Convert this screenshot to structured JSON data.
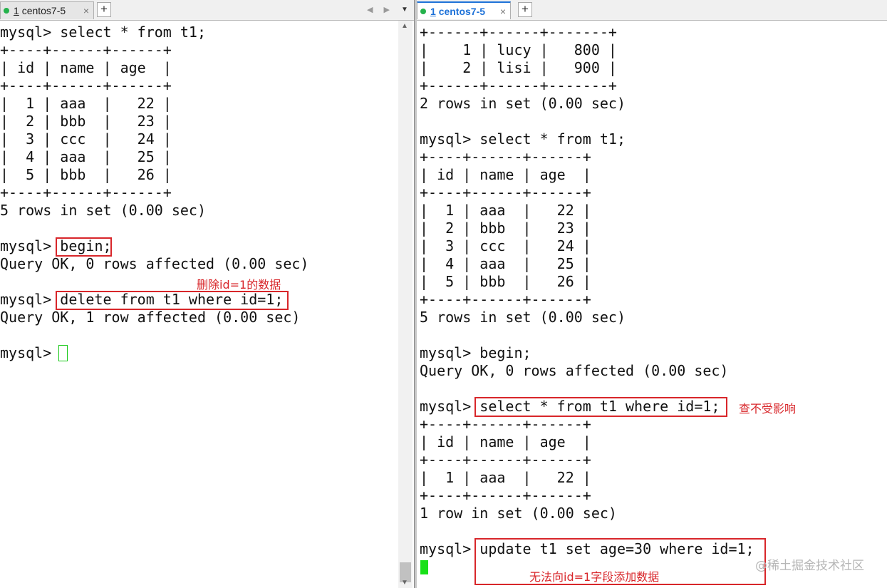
{
  "left": {
    "tab": {
      "num": "1",
      "title": "centos7-5",
      "close": "×"
    },
    "add_tab": "+",
    "nav_arrows": "◀ ▶",
    "menu_arrow": "▼",
    "scroll": {
      "up": "▲",
      "down": "▼"
    },
    "lines": [
      "mysql> select * from t1;",
      "+----+------+------+",
      "| id | name | age  |",
      "+----+------+------+",
      "|  1 | aaa  |   22 |",
      "|  2 | bbb  |   23 |",
      "|  3 | ccc  |   24 |",
      "|  4 | aaa  |   25 |",
      "|  5 | bbb  |   26 |",
      "+----+------+------+",
      "5 rows in set (0.00 sec)",
      "",
      "mysql> begin;",
      "Query OK, 0 rows affected (0.00 sec)",
      "",
      "mysql> delete from t1 where id=1;",
      "Query OK, 1 row affected (0.00 sec)",
      "",
      "mysql> "
    ],
    "note": "删除id=1的数据"
  },
  "right": {
    "tab": {
      "num": "1",
      "title": "centos7-5",
      "close": "×"
    },
    "add_tab": "+",
    "lines": [
      "+------+------+-------+",
      "|    1 | lucy |   800 |",
      "|    2 | lisi |   900 |",
      "+------+------+-------+",
      "2 rows in set (0.00 sec)",
      "",
      "mysql> select * from t1;",
      "+----+------+------+",
      "| id | name | age  |",
      "+----+------+------+",
      "|  1 | aaa  |   22 |",
      "|  2 | bbb  |   23 |",
      "|  3 | ccc  |   24 |",
      "|  4 | aaa  |   25 |",
      "|  5 | bbb  |   26 |",
      "+----+------+------+",
      "5 rows in set (0.00 sec)",
      "",
      "mysql> begin;",
      "Query OK, 0 rows affected (0.00 sec)",
      "",
      "mysql> select * from t1 where id=1;",
      "+----+------+------+",
      "| id | name | age  |",
      "+----+------+------+",
      "|  1 | aaa  |   22 |",
      "+----+------+------+",
      "1 row in set (0.00 sec)",
      "",
      "mysql> update t1 set age=30 where id=1;",
      ""
    ],
    "note_query": "查不受影响",
    "note_update": "无法向id=1字段添加数据"
  },
  "watermark": "@稀土掘金技术社区",
  "colors": {
    "annotation": "#d8262a",
    "active_tab": "#1e72d8",
    "cursor": "#18e018",
    "status_dot": "#24b24b"
  }
}
